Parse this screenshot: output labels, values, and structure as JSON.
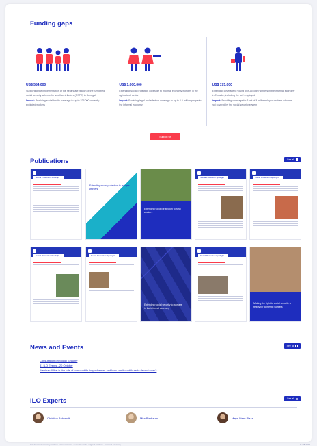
{
  "funding_gaps": {
    "title": "Funding gaps",
    "items": [
      {
        "icon": "family-icon",
        "amount": "US$ 584,000",
        "desc": "Supporting the implementation of the healthcare branch of the Simplified social security scheme for small contributors (RSPC) in Senegal",
        "impact_label": "Impact:",
        "impact": "Providing social health coverage to up to 325 000 currently excluded workers"
      },
      {
        "icon": "group-icon",
        "amount": "US$ 1,000,000",
        "desc": "Extending social protection coverage to informal economy workers in the agricultural sector",
        "impact_label": "Impact:",
        "impact": "Providing legal and effective coverage to up to 3.5 million people in the informal economy"
      },
      {
        "icon": "worker-icon",
        "amount": "US$ 175,000",
        "desc": "Extending coverage to young own-account workers in the informal economy in Ecuador, including the self-employed",
        "impact_label": "Impact:",
        "impact": "Providing coverage for 3 out of 4 self-employed workers who are not covered by the social security system"
      }
    ],
    "button_label": "Support Us"
  },
  "publications": {
    "title": "Publications",
    "see_all": "See all",
    "covers": [
      {
        "label": "Social Protection Spotlight"
      },
      {
        "label": "Extending social protection to refugee workers"
      },
      {
        "label": "Extending social protection to rural workers"
      },
      {
        "label": "Social Protection Spotlight"
      },
      {
        "label": "Social Protection Spotlight"
      },
      {
        "label": "Social Protection Spotlight"
      },
      {
        "label": "Social Protection Spotlight"
      },
      {
        "label": "Extending social security to workers in the informal economy"
      },
      {
        "label": "Social Protection Spotlight"
      },
      {
        "label": "Making the right to social security a reality for domestic workers"
      }
    ]
  },
  "news": {
    "title": "News and Events",
    "see_all": "See all",
    "items": [
      "Consultation on Social Security",
      "31 ILO Events - 20 October",
      "Webinar: What is the role of non-contributory schemes and how can it contribute to decent work?"
    ]
  },
  "experts": {
    "title": "ILO Experts",
    "see_all": "See all",
    "people": [
      {
        "name": "Christina Behrendt"
      },
      {
        "name": "Mira Bierbaum"
      },
      {
        "name": "Maya Stern Plaza"
      }
    ]
  },
  "footer": {
    "left": "ILO   Informal economy workers · rural workers · domestic work · migrant workers · informal economy",
    "right": "1 / 25 2022"
  },
  "colors": {
    "primary": "#1e2dbe",
    "accent": "#fa3c4b",
    "teal": "#1ab0c9"
  }
}
